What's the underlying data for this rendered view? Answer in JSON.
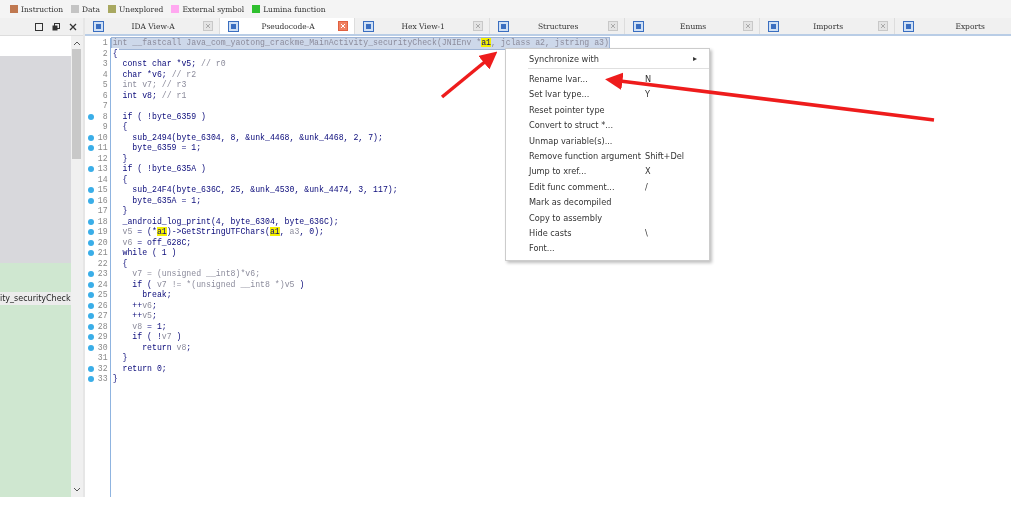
{
  "legend": [
    {
      "label": "Instruction",
      "color": "#c07850"
    },
    {
      "label": "Data",
      "color": "#c4c4c4"
    },
    {
      "label": "Unexplored",
      "color": "#a8a860"
    },
    {
      "label": "External symbol",
      "color": "#ffa8f0"
    },
    {
      "label": "Lumina function",
      "color": "#30c030"
    }
  ],
  "side_panel": {
    "rows": [
      {
        "label": "ity_securityCheck",
        "selected": true
      }
    ]
  },
  "tabs": [
    {
      "label": "IDA View-A",
      "selected": false,
      "close_button": true
    },
    {
      "label": "Pseudocode-A",
      "selected": true,
      "close_button": true
    },
    {
      "label": "Hex View-1",
      "selected": false,
      "close_button": true
    },
    {
      "label": "Structures",
      "selected": false,
      "close_button": true
    },
    {
      "label": "Enums",
      "selected": false,
      "close_button": true
    },
    {
      "label": "Imports",
      "selected": false,
      "close_button": true
    },
    {
      "label": "Exports",
      "selected": false,
      "close_button": false
    }
  ],
  "code": {
    "lines": [
      {
        "n": "1",
        "marked": false,
        "selected": true,
        "tokens": [
          {
            "t": "int __fastcall Java_com_yaotong_crackme_MainActivity_securityCheck(JNIEnv *",
            "kind": "dim"
          },
          {
            "t": "a1",
            "kind": "hl"
          },
          {
            "t": ", jclass a2, jstring a3)",
            "kind": "dim"
          }
        ]
      },
      {
        "n": "2",
        "marked": false,
        "selected": false,
        "tokens": [
          {
            "t": "{",
            "kind": "code"
          }
        ]
      },
      {
        "n": "3",
        "marked": false,
        "selected": false,
        "tokens": [
          {
            "t": "  const char *v5; ",
            "kind": "code"
          },
          {
            "t": "// r0",
            "kind": "dim"
          }
        ]
      },
      {
        "n": "4",
        "marked": false,
        "selected": false,
        "tokens": [
          {
            "t": "  char *v6; ",
            "kind": "code"
          },
          {
            "t": "// r2",
            "kind": "dim"
          }
        ]
      },
      {
        "n": "5",
        "marked": false,
        "selected": false,
        "tokens": [
          {
            "t": "  int v7; // r3",
            "kind": "dim"
          }
        ]
      },
      {
        "n": "6",
        "marked": false,
        "selected": false,
        "tokens": [
          {
            "t": "  int v8; ",
            "kind": "code"
          },
          {
            "t": "// r1",
            "kind": "dim"
          }
        ]
      },
      {
        "n": "7",
        "marked": false
      },
      {
        "n": "8",
        "marked": true,
        "selected": false,
        "tokens": [
          {
            "t": "  if ( !byte_6359 )",
            "kind": "code"
          }
        ]
      },
      {
        "n": "9",
        "marked": false,
        "selected": false,
        "tokens": [
          {
            "t": "  {",
            "kind": "code"
          }
        ]
      },
      {
        "n": "10",
        "marked": true,
        "selected": false,
        "tokens": [
          {
            "t": "    sub_2494(byte_6304, 8, &unk_4468, &unk_4468, 2, 7);",
            "kind": "code"
          }
        ]
      },
      {
        "n": "11",
        "marked": true,
        "selected": false,
        "tokens": [
          {
            "t": "    byte_6359 = 1;",
            "kind": "code"
          }
        ]
      },
      {
        "n": "12",
        "marked": false,
        "selected": false,
        "tokens": [
          {
            "t": "  }",
            "kind": "code"
          }
        ]
      },
      {
        "n": "13",
        "marked": true,
        "selected": false,
        "tokens": [
          {
            "t": "  if ( !byte_635A )",
            "kind": "code"
          }
        ]
      },
      {
        "n": "14",
        "marked": false,
        "selected": false,
        "tokens": [
          {
            "t": "  {",
            "kind": "code"
          }
        ]
      },
      {
        "n": "15",
        "marked": true,
        "selected": false,
        "tokens": [
          {
            "t": "    sub_24F4(byte_636C, 25, &unk_4530, &unk_4474, 3, 117);",
            "kind": "code"
          }
        ]
      },
      {
        "n": "16",
        "marked": true,
        "selected": false,
        "tokens": [
          {
            "t": "    byte_635A = 1;",
            "kind": "code"
          }
        ]
      },
      {
        "n": "17",
        "marked": false,
        "selected": false,
        "tokens": [
          {
            "t": "  }",
            "kind": "code"
          }
        ]
      },
      {
        "n": "18",
        "marked": true,
        "selected": false,
        "tokens": [
          {
            "t": "  _android_log_print(4, byte_6304, byte_636C);",
            "kind": "code"
          }
        ]
      },
      {
        "n": "19",
        "marked": true,
        "selected": false,
        "tokens": [
          {
            "t": "  v5",
            "kind": "dim"
          },
          {
            "t": " = (*",
            "kind": "code"
          },
          {
            "t": "a1",
            "kind": "hl"
          },
          {
            "t": ")->GetStringUTFChars(",
            "kind": "code"
          },
          {
            "t": "a1",
            "kind": "hl"
          },
          {
            "t": ", ",
            "kind": "code"
          },
          {
            "t": "a3",
            "kind": "dim"
          },
          {
            "t": ", 0);",
            "kind": "code"
          }
        ]
      },
      {
        "n": "20",
        "marked": true,
        "selected": false,
        "tokens": [
          {
            "t": "  v6",
            "kind": "dim"
          },
          {
            "t": " = off_628C;",
            "kind": "code"
          }
        ]
      },
      {
        "n": "21",
        "marked": true,
        "selected": false,
        "tokens": [
          {
            "t": "  while ( 1 )",
            "kind": "code"
          }
        ]
      },
      {
        "n": "22",
        "marked": false,
        "selected": false,
        "tokens": [
          {
            "t": "  {",
            "kind": "code"
          }
        ]
      },
      {
        "n": "23",
        "marked": true,
        "selected": false,
        "tokens": [
          {
            "t": "    v7 = (unsigned __int8)*v6;",
            "kind": "dim"
          }
        ]
      },
      {
        "n": "24",
        "marked": true,
        "selected": false,
        "tokens": [
          {
            "t": "    if ( ",
            "kind": "code"
          },
          {
            "t": "v7 != *(unsigned __int8 *)v5",
            "kind": "dim"
          },
          {
            "t": " )",
            "kind": "code"
          }
        ]
      },
      {
        "n": "25",
        "marked": true,
        "selected": false,
        "tokens": [
          {
            "t": "      break;",
            "kind": "code"
          }
        ]
      },
      {
        "n": "26",
        "marked": true,
        "selected": false,
        "tokens": [
          {
            "t": "    ++",
            "kind": "code"
          },
          {
            "t": "v6",
            "kind": "dim"
          },
          {
            "t": ";",
            "kind": "code"
          }
        ]
      },
      {
        "n": "27",
        "marked": true,
        "selected": false,
        "tokens": [
          {
            "t": "    ++",
            "kind": "code"
          },
          {
            "t": "v5",
            "kind": "dim"
          },
          {
            "t": ";",
            "kind": "code"
          }
        ]
      },
      {
        "n": "28",
        "marked": true,
        "selected": false,
        "tokens": [
          {
            "t": "    v8",
            "kind": "dim"
          },
          {
            "t": " = 1;",
            "kind": "code"
          }
        ]
      },
      {
        "n": "29",
        "marked": true,
        "selected": false,
        "tokens": [
          {
            "t": "    if ( !",
            "kind": "code"
          },
          {
            "t": "v7",
            "kind": "dim"
          },
          {
            "t": " )",
            "kind": "code"
          }
        ]
      },
      {
        "n": "30",
        "marked": true,
        "selected": false,
        "tokens": [
          {
            "t": "      return ",
            "kind": "code"
          },
          {
            "t": "v8",
            "kind": "dim"
          },
          {
            "t": ";",
            "kind": "code"
          }
        ]
      },
      {
        "n": "31",
        "marked": false,
        "selected": false,
        "tokens": [
          {
            "t": "  }",
            "kind": "code"
          }
        ]
      },
      {
        "n": "32",
        "marked": true,
        "selected": false,
        "tokens": [
          {
            "t": "  return 0;",
            "kind": "code"
          }
        ]
      },
      {
        "n": "33",
        "marked": true,
        "selected": false,
        "tokens": [
          {
            "t": "}",
            "kind": "code"
          }
        ]
      }
    ]
  },
  "context_menu": [
    {
      "kind": "submenu",
      "label": "Synchronize with",
      "arrow": "▸"
    },
    {
      "kind": "separator"
    },
    {
      "kind": "item",
      "label": "Rename lvar...",
      "shortcut": "N"
    },
    {
      "kind": "item",
      "label": "Set lvar type...",
      "shortcut": "Y"
    },
    {
      "kind": "item",
      "label": "Reset pointer type"
    },
    {
      "kind": "item",
      "label": "Convert to struct *..."
    },
    {
      "kind": "item",
      "label": "Unmap variable(s)..."
    },
    {
      "kind": "item",
      "label": "Remove function argument",
      "shortcut": "Shift+Del"
    },
    {
      "kind": "item",
      "label": "Jump to xref...",
      "shortcut": "X"
    },
    {
      "kind": "item",
      "label": "Edit func comment...",
      "shortcut": "/"
    },
    {
      "kind": "item",
      "label": "Mark as decompiled"
    },
    {
      "kind": "item",
      "label": "Copy to assembly"
    },
    {
      "kind": "item",
      "label": "Hide casts",
      "shortcut": "\\"
    },
    {
      "kind": "item",
      "label": "Font..."
    }
  ]
}
